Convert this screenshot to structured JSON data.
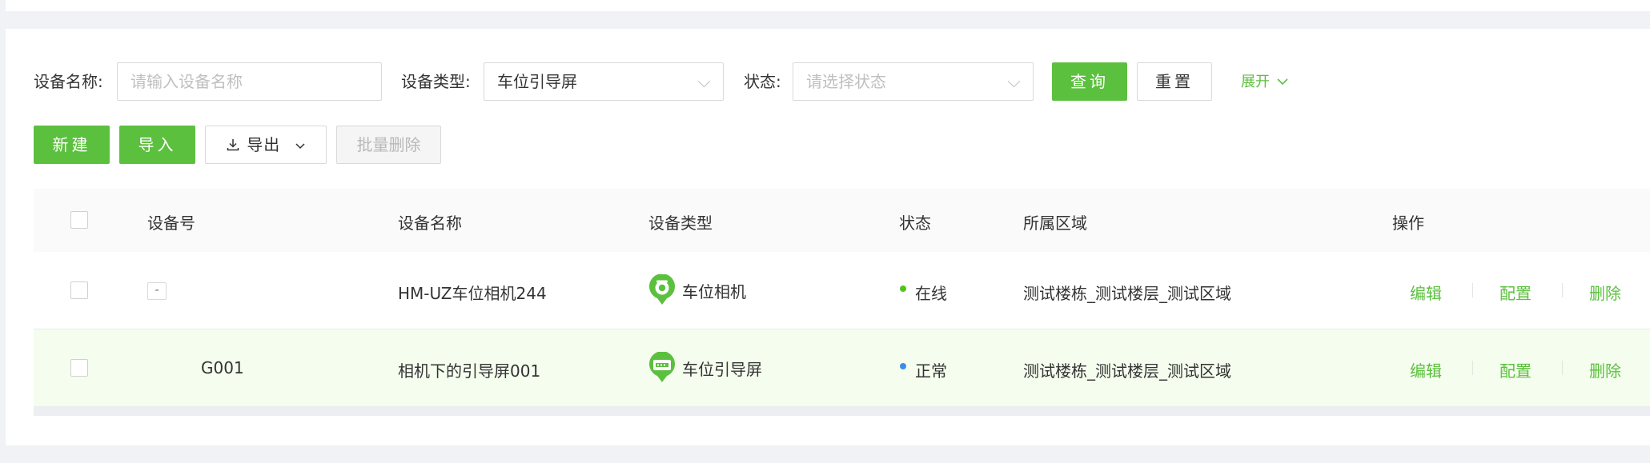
{
  "filters": {
    "device_name_label": "设备名称:",
    "device_name_placeholder": "请输入设备名称",
    "device_type_label": "设备类型:",
    "device_type_value": "车位引导屏",
    "status_label": "状态:",
    "status_placeholder": "请选择状态",
    "query_label": "查询",
    "reset_label": "重置",
    "expand_label": "展开"
  },
  "toolbar": {
    "new_label": "新建",
    "import_label": "导入",
    "export_label": "导出",
    "batch_delete_label": "批量删除"
  },
  "table": {
    "headers": [
      "设备号",
      "设备名称",
      "设备类型",
      "状态",
      "所属区域",
      "操作"
    ],
    "rows": [
      {
        "device_no": "",
        "device_name": "HM-UZ车位相机244",
        "device_type": "车位相机",
        "status": "在线",
        "status_color": "#52c41a",
        "area": "测试楼栋_测试楼层_测试区域"
      },
      {
        "device_no": "G001",
        "device_name": "相机下的引导屏001",
        "device_type": "车位引导屏",
        "status": "正常",
        "status_color": "#3a8ee6",
        "area": "测试楼栋_测试楼层_测试区域"
      }
    ],
    "actions": {
      "edit": "编辑",
      "config": "配置",
      "delete": "删除"
    }
  },
  "colors": {
    "primary": "#5cc03f",
    "row_highlight": "#f4fdee"
  }
}
